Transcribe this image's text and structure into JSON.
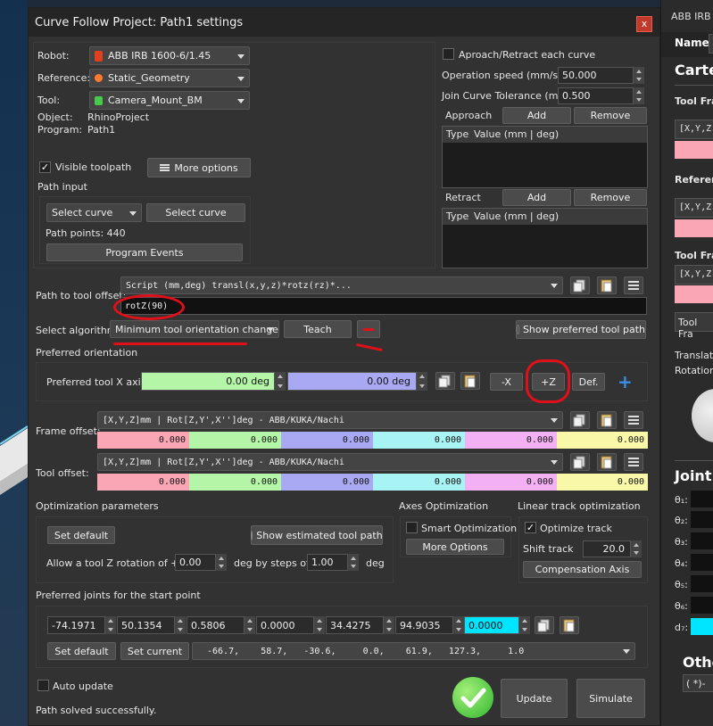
{
  "window": {
    "title": "Curve Follow Project: Path1 settings",
    "close": "x"
  },
  "left": {
    "robot_label": "Robot:",
    "robot_value": "ABB IRB 1600-6/1.45",
    "reference_label": "Reference:",
    "reference_value": "Static_Geometry",
    "tool_label": "Tool:",
    "tool_value": "Camera_Mount_BM",
    "object_label": "Object:",
    "object_value": "RhinoProject",
    "program_label": "Program:",
    "program_value": "Path1",
    "visible_toolpath": "Visible toolpath",
    "more_options": "More options",
    "path_input": "Path input",
    "select_curve_combo": "Select curve",
    "select_curve_btn": "Select curve",
    "path_points": "Path points: 440",
    "program_events": "Program Events"
  },
  "right": {
    "approach_retract": "Aproach/Retract each curve",
    "op_speed_label": "Operation speed (mm/s)",
    "op_speed_value": "50.000",
    "join_tol_label": "Join Curve Tolerance (mm)",
    "join_tol_value": "0.500",
    "approach_label": "Approach",
    "retract_label": "Retract",
    "add": "Add",
    "remove": "Remove",
    "type_header": "Type",
    "value_header": "Value (mm | deg)"
  },
  "offset": {
    "label": "Path to tool offset:",
    "script": "Script (mm,deg) transl(x,y,z)*rotz(rz)*...",
    "value": "rotZ(90)"
  },
  "algorithm": {
    "label": "Select algorithm:",
    "value": "Minimum tool orientation change",
    "teach": "Teach",
    "show_preferred": "Show preferred tool path"
  },
  "preferred": {
    "header": "Preferred orientation",
    "label": "Preferred tool X axis",
    "val1": "0.00 deg",
    "val2": "0.00 deg",
    "minus_x": "-X",
    "plus_z": "+Z",
    "def": "Def."
  },
  "frame_offset": {
    "label": "Frame offset:",
    "format": "[X,Y,Z]mm | Rot[Z,Y',X'']deg - ABB/KUKA/Nachi",
    "values": [
      "0.000",
      "0.000",
      "0.000",
      "0.000",
      "0.000",
      "0.000"
    ]
  },
  "tool_offset": {
    "label": "Tool offset:",
    "format": "[X,Y,Z]mm | Rot[Z,Y',X'']deg - ABB/KUKA/Nachi",
    "values": [
      "0.000",
      "0.000",
      "0.000",
      "0.000",
      "0.000",
      "0.000"
    ]
  },
  "optimization": {
    "header": "Optimization parameters",
    "set_default": "Set default",
    "show_estimated": "Show estimated tool path",
    "allow_label": "Allow a tool Z rotation of +/-",
    "allow_value": "0.00",
    "steps_label": "deg by steps of",
    "steps_value": "1.00",
    "deg": "deg"
  },
  "axes_opt": {
    "header": "Axes Optimization",
    "smart": "Smart Optimization",
    "more": "More Options"
  },
  "linear": {
    "header": "Linear track optimization",
    "optimize": "Optimize track",
    "shift_label": "Shift track",
    "shift_value": "20.0",
    "compensation": "Compensation Axis"
  },
  "joints": {
    "header": "Preferred joints for the start point",
    "values": [
      "-74.1971",
      "50.1354",
      "0.5806",
      "0.0000",
      "34.4275",
      "94.9035",
      "0.0000"
    ],
    "set_default": "Set default",
    "set_current": "Set current",
    "current": "-66.7,    58.7,   -30.6,     0.0,    61.9,   127.3,     1.0"
  },
  "footer": {
    "auto_update": "Auto update",
    "status": "Path solved successfully.",
    "update": "Update",
    "simulate": "Simulate"
  },
  "side": {
    "title": "ABB IRB",
    "name": "Name:",
    "carte": "Carte",
    "tool_fra": "Tool Fra",
    "xyz1": "[X,Y,Z",
    "refer": "Referen",
    "xyz2": "[X,Y,Z",
    "tool_fra2": "Tool Fra",
    "xyz3": "[X,Y,Z",
    "tool_fra3": "Tool Fra",
    "transl": "Translati",
    "rotation": "Rotation",
    "joint": "Joint",
    "j1": "θ₁:",
    "j2": "θ₂:",
    "j3": "θ₃:",
    "j4": "θ₄:",
    "j5": "θ₅:",
    "j6": "θ₆:",
    "d7": "d₇:",
    "other": "Othe",
    "other_val": "( *)-"
  },
  "colors": {
    "x": "#fba6b4",
    "y": "#b4f5a8",
    "z": "#a9a9f3",
    "rx": "#a8f3f3",
    "ry": "#f3b0f3",
    "rz": "#f8f8a8"
  }
}
